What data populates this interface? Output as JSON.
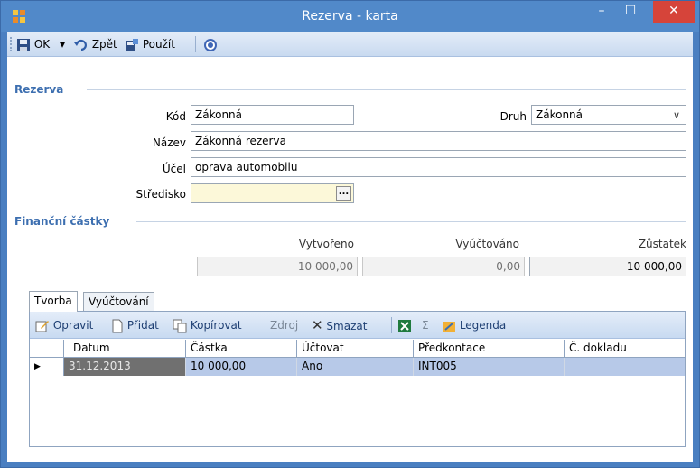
{
  "window": {
    "title": "Rezerva - karta",
    "min_glyph": "–",
    "max_glyph": "☐",
    "close_glyph": "✕"
  },
  "toolbar": {
    "ok_label": "OK",
    "ok_dropdown_glyph": "▾",
    "back_label": "Zpět",
    "apply_label": "Použít"
  },
  "reserve": {
    "section_title": "Rezerva",
    "code_label": "Kód",
    "code_value": "Zákonná",
    "kind_label": "Druh",
    "kind_value": "Zákonná",
    "name_label": "Název",
    "name_value": "Zákonná rezerva",
    "purpose_label": "Účel",
    "purpose_value": "oprava automobilu",
    "center_label": "Středisko",
    "center_value": "",
    "center_button": "..."
  },
  "amounts": {
    "section_title": "Finanční částky",
    "created_label": "Vytvořeno",
    "created_value": "10 000,00",
    "settled_label": "Vyúčtováno",
    "settled_value": "0,00",
    "balance_label": "Zůstatek",
    "balance_value": "10 000,00"
  },
  "tabs": [
    {
      "label": "Tvorba",
      "active": true
    },
    {
      "label": "Vyúčtování",
      "active": false
    }
  ],
  "grid_toolbar": {
    "edit": "Opravit",
    "add": "Přidat",
    "copy": "Kopírovat",
    "source": "Zdroj",
    "delete": "Smazat",
    "sum_glyph": "Σ",
    "legend": "Legenda"
  },
  "grid": {
    "columns": [
      "Datum",
      "Částka",
      "Účtovat",
      "Předkontace",
      "Č. dokladu"
    ],
    "rows": [
      {
        "indicator": "▶",
        "cells": [
          "31.12.2013",
          "10 000,00",
          "Ano",
          "INT005",
          ""
        ]
      }
    ]
  },
  "colors": {
    "title_bar": "#5189c9",
    "section_title": "#3d6fb0",
    "selected_row": "#b7c9e8",
    "close_button": "#d6443a"
  }
}
